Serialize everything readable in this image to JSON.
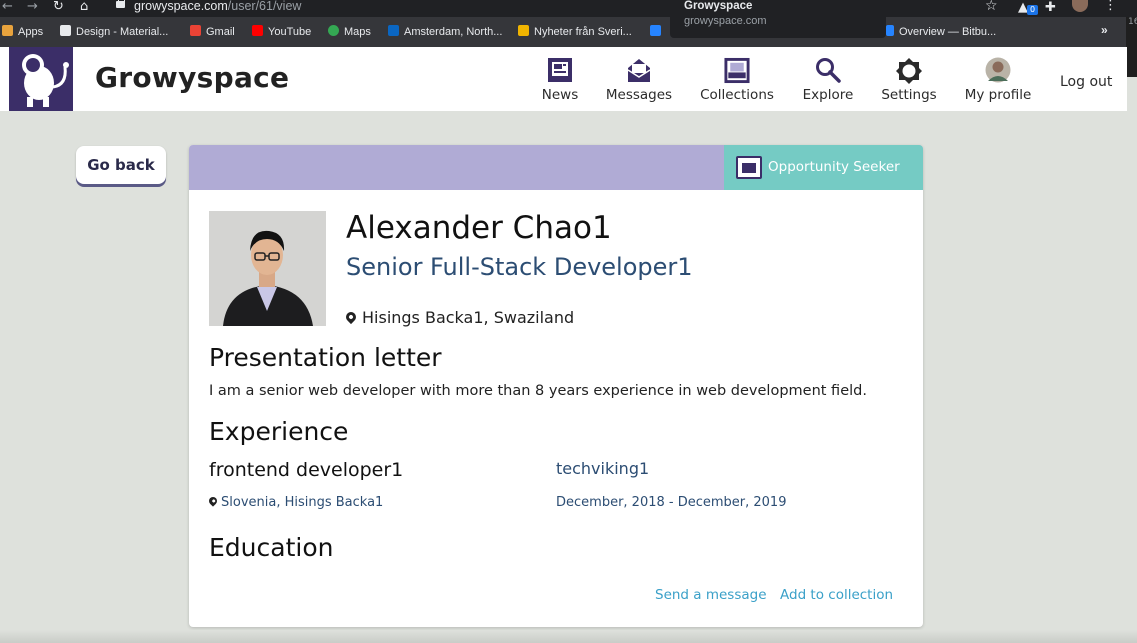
{
  "browser": {
    "url_domain": "growyspace.com",
    "url_path": "/user/61/view",
    "tooltip_title": "Growyspace",
    "tooltip_domain": "growyspace.com",
    "ext_badge": "0",
    "scroll_label": "16"
  },
  "bookmarks": [
    {
      "label": "Apps",
      "icon_color": "#e8a33d"
    },
    {
      "label": "Design - Material...",
      "icon_color": "#e8eaed"
    },
    {
      "label": "Gmail",
      "icon_color": "#ea4335"
    },
    {
      "label": "YouTube",
      "icon_color": "#ff0000"
    },
    {
      "label": "Maps",
      "icon_color": "#34a853"
    },
    {
      "label": "Amsterdam, North...",
      "icon_color": "#0a66c2"
    },
    {
      "label": "Nyheter från Sveri...",
      "icon_color": "#f0b400"
    },
    {
      "label": "Overview — Bitbu...",
      "icon_color": "#2684ff"
    }
  ],
  "header": {
    "brand": "Growyspace",
    "nav": [
      {
        "label": "News",
        "icon": "news-icon"
      },
      {
        "label": "Messages",
        "icon": "envelope-icon"
      },
      {
        "label": "Collections",
        "icon": "collections-icon"
      },
      {
        "label": "Explore",
        "icon": "search-icon"
      },
      {
        "label": "Settings",
        "icon": "gear-icon"
      },
      {
        "label": "My profile",
        "icon": "avatar-icon"
      }
    ],
    "logout": "Log out"
  },
  "go_back": "Go back",
  "profile": {
    "tag": "Opportunity Seeker",
    "name": "Alexander Chao1",
    "role": "Senior Full-Stack Developer1",
    "location": "Hisings Backa1, Swaziland",
    "presentation_heading": "Presentation letter",
    "presentation_text": "I am a senior web developer with more than 8 years experience in web development field.",
    "experience_heading": "Experience",
    "experience": [
      {
        "title": "frontend developer1",
        "company": "techviking1",
        "location": "Slovenia, Hisings Backa1",
        "dates": "December, 2018 - December, 2019"
      }
    ],
    "education_heading": "Education",
    "actions": {
      "send_message": "Send a message",
      "add_collection": "Add to collection"
    }
  },
  "colors": {
    "brand_purple": "#3b2e68",
    "card_top": "#b0abd5",
    "tag_teal": "#75cbc4",
    "link_blue": "#3aa0c8",
    "heading_blue": "#2c4d73"
  }
}
